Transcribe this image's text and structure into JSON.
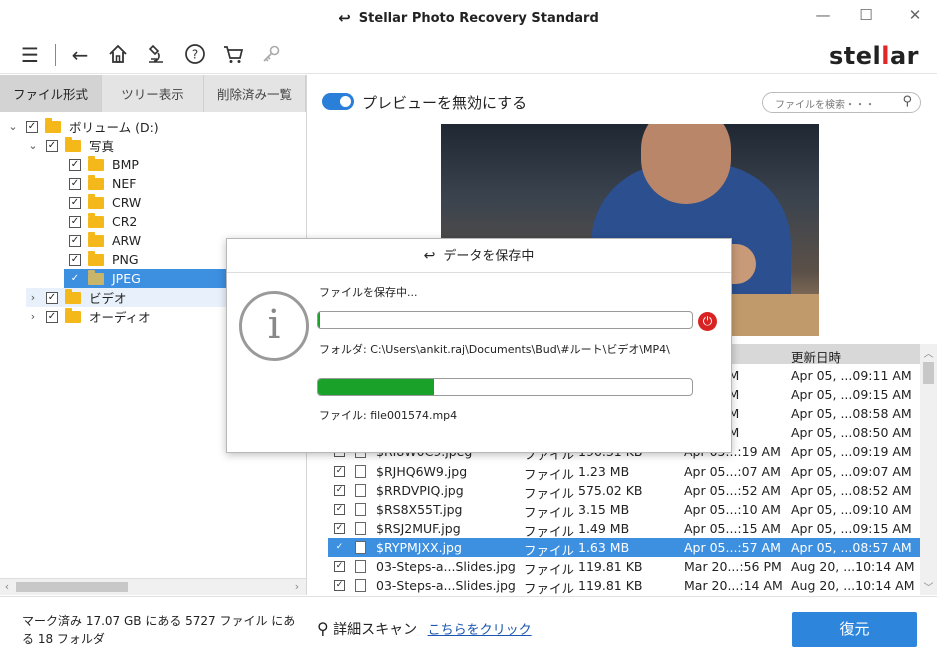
{
  "window": {
    "title": "Stellar Photo Recovery Standard",
    "minimize": "—",
    "maximize": "☐",
    "close": "✕"
  },
  "toolbar": {
    "brand_prefix": "stel",
    "brand_accent": "l",
    "brand_suffix": "ar",
    "icons": [
      "menu-icon",
      "back-icon",
      "home-icon",
      "microscope-icon",
      "help-icon",
      "cart-icon",
      "key-icon"
    ]
  },
  "tabs": [
    "ファイル形式",
    "ツリー表示",
    "削除済み一覧"
  ],
  "tree": [
    {
      "label": "ボリューム (D:)",
      "expander": "⌄",
      "checked": "✓"
    },
    {
      "label": "写真",
      "expander": "⌄",
      "checked": "✓"
    },
    {
      "label": "BMP",
      "checked": "✓"
    },
    {
      "label": "NEF",
      "checked": "✓"
    },
    {
      "label": "CRW",
      "checked": "✓"
    },
    {
      "label": "CR2",
      "checked": "✓"
    },
    {
      "label": "ARW",
      "checked": "✓"
    },
    {
      "label": "PNG",
      "checked": "✓"
    },
    {
      "label": "JPEG",
      "checked": "✓",
      "selected": true
    },
    {
      "label": "ビデオ",
      "expander": "›",
      "checked": "✓"
    },
    {
      "label": "オーディオ",
      "expander": "›",
      "checked": "✓"
    }
  ],
  "preview": {
    "toggle_label": "プレビューを無効にする",
    "search_placeholder": "ファイルを検索・・・"
  },
  "table": {
    "headers": {
      "created": "時",
      "modified": "更新日時"
    },
    "rows": [
      {
        "name": "",
        "type": "",
        "size": "",
        "created": "...:11 AM",
        "modified": "Apr 05, ...09:11 AM"
      },
      {
        "name": "",
        "type": "",
        "size": "",
        "created": "...:15 AM",
        "modified": "Apr 05, ...09:15 AM"
      },
      {
        "name": "",
        "type": "",
        "size": "",
        "created": "...:58 AM",
        "modified": "Apr 05, ...08:58 AM"
      },
      {
        "name": "",
        "type": "",
        "size": "",
        "created": "...:49 AM",
        "modified": "Apr 05, ...08:50 AM"
      },
      {
        "name": "$RI8W0C9.jpeg",
        "type": "ファイル",
        "size": "196.31 KB",
        "created": "Apr 05...:19 AM",
        "modified": "Apr 05, ...09:19 AM"
      },
      {
        "name": "$RJHQ6W9.jpg",
        "type": "ファイル",
        "size": "1.23 MB",
        "created": "Apr 05...:07 AM",
        "modified": "Apr 05, ...09:07 AM"
      },
      {
        "name": "$RRDVPIQ.jpg",
        "type": "ファイル",
        "size": "575.02 KB",
        "created": "Apr 05...:52 AM",
        "modified": "Apr 05, ...08:52 AM"
      },
      {
        "name": "$RS8X55T.jpg",
        "type": "ファイル",
        "size": "3.15 MB",
        "created": "Apr 05...:10 AM",
        "modified": "Apr 05, ...09:10 AM"
      },
      {
        "name": "$RSJ2MUF.jpg",
        "type": "ファイル",
        "size": "1.49 MB",
        "created": "Apr 05...:15 AM",
        "modified": "Apr 05, ...09:15 AM"
      },
      {
        "name": "$RYPMJXX.jpg",
        "type": "ファイル",
        "size": "1.63 MB",
        "created": "Apr 05...:57 AM",
        "modified": "Apr 05, ...08:57 AM",
        "selected": true
      },
      {
        "name": "03-Steps-a...Slides.jpg",
        "type": "ファイル",
        "size": "119.81 KB",
        "created": "Mar 20...:56 PM",
        "modified": "Aug 20, ...10:14 AM"
      },
      {
        "name": "03-Steps-a...Slides.jpg",
        "type": "ファイル",
        "size": "119.81 KB",
        "created": "Mar 20...:14 AM",
        "modified": "Aug 20, ...10:14 AM"
      }
    ]
  },
  "dialog": {
    "title": "データを保存中",
    "saving_label": "ファイルを保存中...",
    "folder_label": "フォルダ: C:\\Users\\ankit.raj\\Documents\\Bud\\#ルート\\ビデオ\\MP4\\",
    "file_label": "ファイル: file001574.mp4",
    "overall_progress": 0.005,
    "file_progress": 0.31,
    "info_glyph": "i",
    "stop_glyph": "⏻"
  },
  "bottom": {
    "status_text": "マーク済み 17.07 GB にある 5727 ファイル にある 18 フォルダ",
    "deep_scan_label": "詳細スキャン",
    "deep_scan_link": "こちらをクリック",
    "recover_button": "復元"
  },
  "colors": {
    "accent_blue": "#2d86dc",
    "selection_blue": "#3d8fe0",
    "progress_green": "#1aa12a",
    "brand_red": "#e02626",
    "folder_yellow": "#f5b81b"
  }
}
